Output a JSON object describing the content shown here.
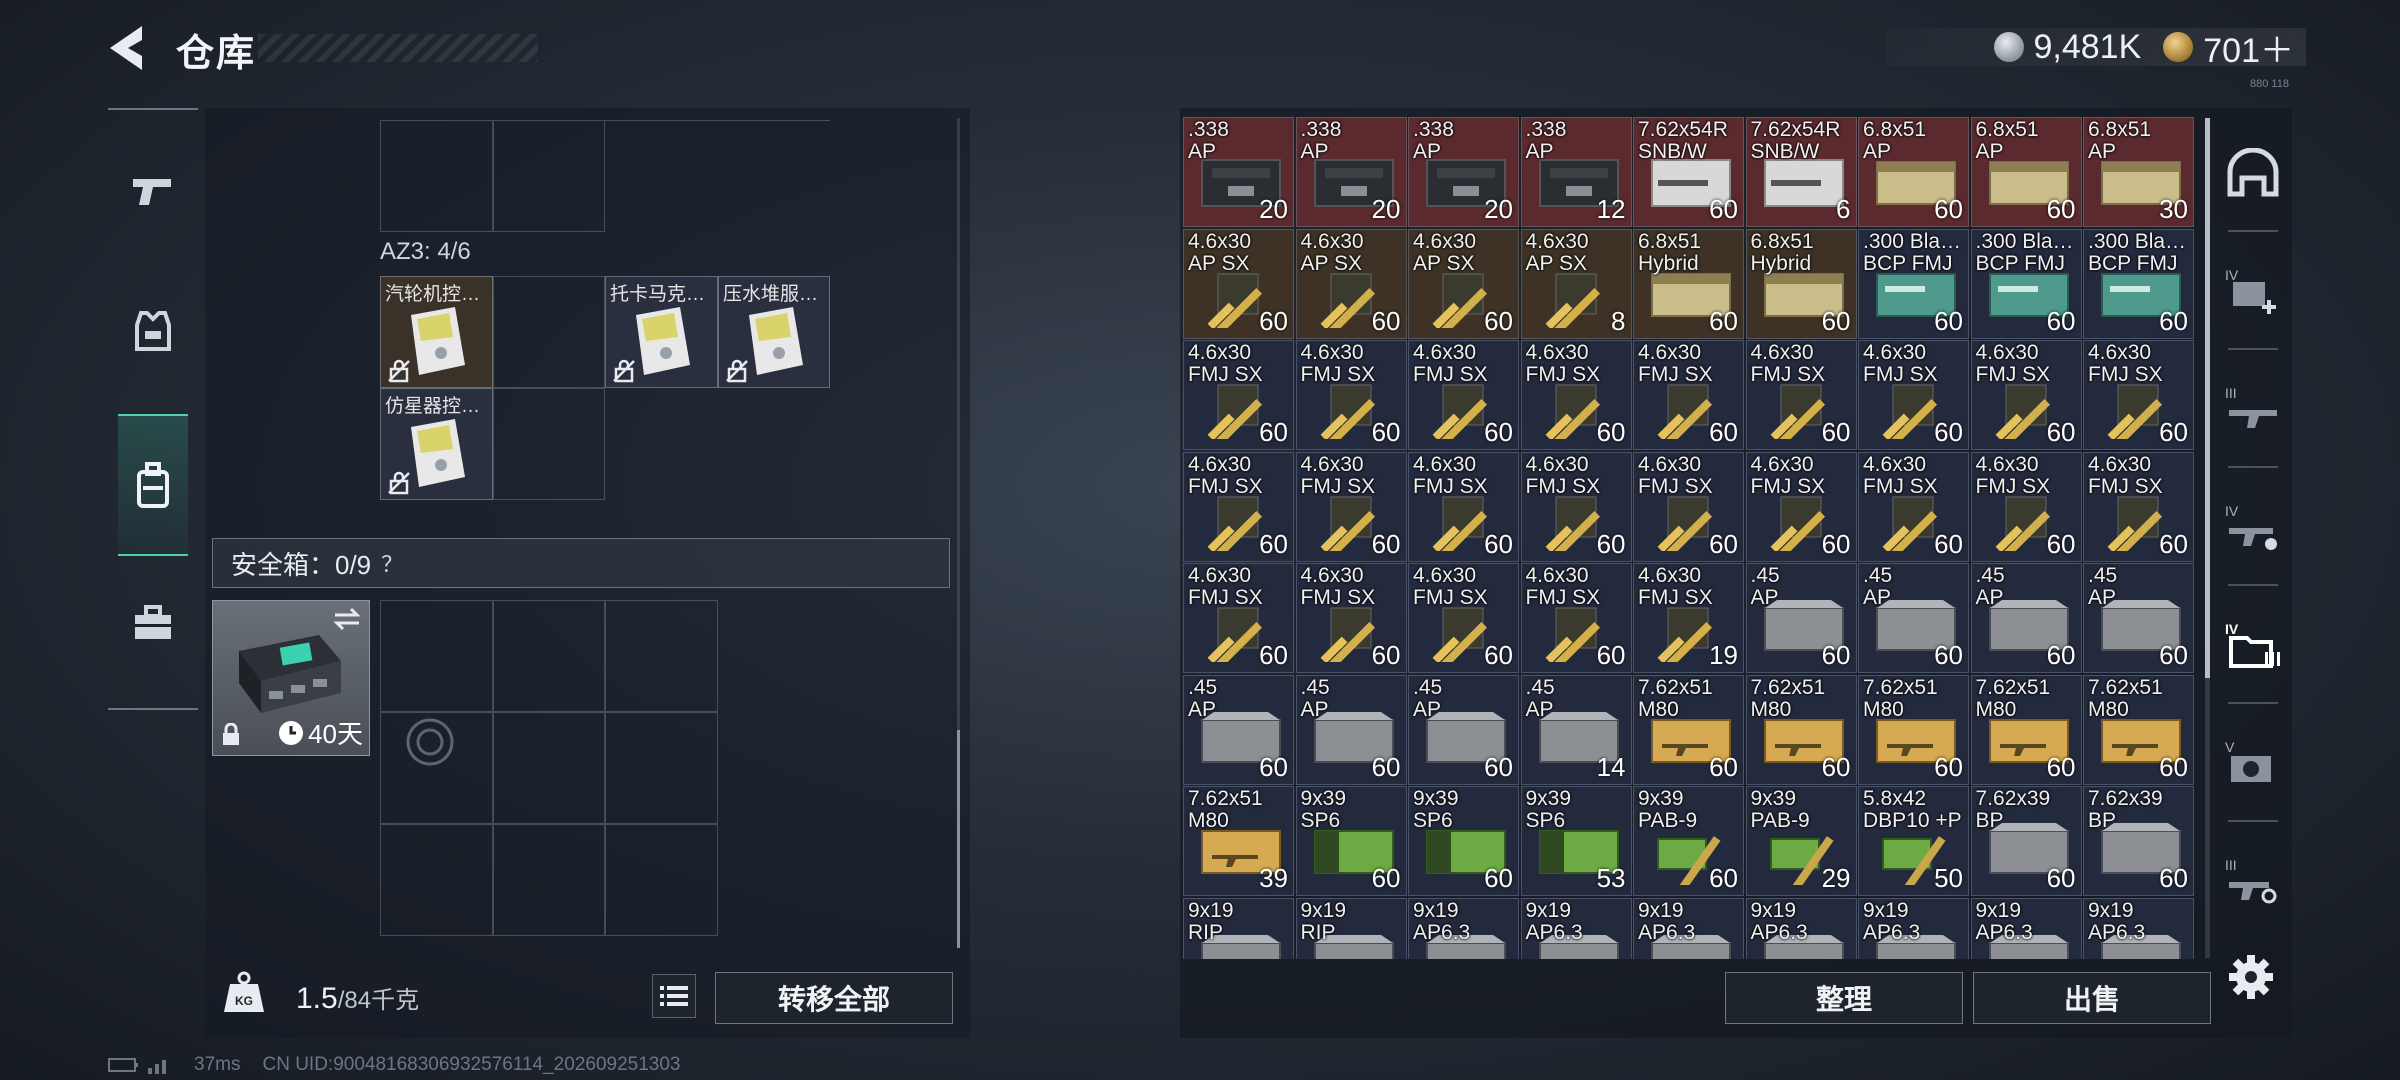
{
  "header": {
    "title": "仓库",
    "currency_silver": "9,481K",
    "currency_gold": "701＋",
    "tiny_text": "880 118"
  },
  "left_nav": {
    "items": [
      "pistol-icon",
      "armor-vest-icon",
      "backpack-icon",
      "toolbox-icon"
    ],
    "active_index": 2
  },
  "container": {
    "label": "AZ3: 4/6",
    "items": [
      {
        "name": "汽轮机控…",
        "style": "brown"
      },
      {
        "name": "托卡马克…",
        "style": "dark"
      },
      {
        "name": "压水堆服…",
        "style": "dark"
      },
      {
        "name": "仿星器控…",
        "style": "dark"
      }
    ]
  },
  "safe_box": {
    "label": "安全箱：0/9",
    "help": "？",
    "duration": "40天"
  },
  "weight": {
    "current": "1.5",
    "max": "/84千克"
  },
  "buttons": {
    "transfer_all": "转移全部",
    "sort": "整理",
    "sell": "出售"
  },
  "status": {
    "ping": "37ms",
    "uid": "CN UID:90048168306932576114_202609251303"
  },
  "colors": {
    "accent": "#4fd0a8",
    "red_cell": "#5a2a2e",
    "brown_cell": "#3d3225",
    "blue_cell": "#242a3e"
  },
  "right_tabs": [
    "helmet-icon",
    "iv-plus-icon",
    "iii-rifle-icon",
    "iv-settings-icon",
    "iv-folder-icon",
    "v-camera-icon",
    "iii-tool-icon"
  ],
  "inventory": [
    [
      {
        "n1": ".338",
        "n2": "AP",
        "c": "20",
        "bg": "red",
        "art": "box-dark"
      },
      {
        "n1": ".338",
        "n2": "AP",
        "c": "20",
        "bg": "red",
        "art": "box-dark"
      },
      {
        "n1": ".338",
        "n2": "AP",
        "c": "20",
        "bg": "red",
        "art": "box-dark"
      },
      {
        "n1": ".338",
        "n2": "AP",
        "c": "12",
        "bg": "red",
        "art": "box-dark"
      },
      {
        "n1": "7.62x54R",
        "n2": "SNB/W",
        "c": "60",
        "bg": "red",
        "art": "box-white"
      },
      {
        "n1": "7.62x54R",
        "n2": "SNB/W",
        "c": "6",
        "bg": "red",
        "art": "box-white"
      },
      {
        "n1": "6.8x51",
        "n2": "AP",
        "c": "60",
        "bg": "red",
        "art": "box-tan"
      },
      {
        "n1": "6.8x51",
        "n2": "AP",
        "c": "60",
        "bg": "red",
        "art": "box-tan"
      },
      {
        "n1": "6.8x51",
        "n2": "AP",
        "c": "30",
        "bg": "red",
        "art": "box-tan"
      }
    ],
    [
      {
        "n1": "4.6x30",
        "n2": "AP SX",
        "c": "60",
        "bg": "brown",
        "art": "shell"
      },
      {
        "n1": "4.6x30",
        "n2": "AP SX",
        "c": "60",
        "bg": "brown",
        "art": "shell"
      },
      {
        "n1": "4.6x30",
        "n2": "AP SX",
        "c": "60",
        "bg": "brown",
        "art": "shell"
      },
      {
        "n1": "4.6x30",
        "n2": "AP SX",
        "c": "8",
        "bg": "brown",
        "art": "shell"
      },
      {
        "n1": "6.8x51",
        "n2": "Hybrid",
        "c": "60",
        "bg": "brown",
        "art": "box-tan"
      },
      {
        "n1": "6.8x51",
        "n2": "Hybrid",
        "c": "60",
        "bg": "brown",
        "art": "box-tan"
      },
      {
        "n1": ".300 Bla…",
        "n2": "BCP FMJ",
        "c": "60",
        "bg": "blue",
        "art": "box-teal"
      },
      {
        "n1": ".300 Bla…",
        "n2": "BCP FMJ",
        "c": "60",
        "bg": "blue",
        "art": "box-teal"
      },
      {
        "n1": ".300 Bla…",
        "n2": "BCP FMJ",
        "c": "60",
        "bg": "blue",
        "art": "box-teal"
      }
    ],
    [
      {
        "n1": "4.6x30",
        "n2": "FMJ SX",
        "c": "60",
        "bg": "blue",
        "art": "shell"
      },
      {
        "n1": "4.6x30",
        "n2": "FMJ SX",
        "c": "60",
        "bg": "blue",
        "art": "shell"
      },
      {
        "n1": "4.6x30",
        "n2": "FMJ SX",
        "c": "60",
        "bg": "blue",
        "art": "shell"
      },
      {
        "n1": "4.6x30",
        "n2": "FMJ SX",
        "c": "60",
        "bg": "blue",
        "art": "shell"
      },
      {
        "n1": "4.6x30",
        "n2": "FMJ SX",
        "c": "60",
        "bg": "blue",
        "art": "shell"
      },
      {
        "n1": "4.6x30",
        "n2": "FMJ SX",
        "c": "60",
        "bg": "blue",
        "art": "shell"
      },
      {
        "n1": "4.6x30",
        "n2": "FMJ SX",
        "c": "60",
        "bg": "blue",
        "art": "shell"
      },
      {
        "n1": "4.6x30",
        "n2": "FMJ SX",
        "c": "60",
        "bg": "blue",
        "art": "shell"
      },
      {
        "n1": "4.6x30",
        "n2": "FMJ SX",
        "c": "60",
        "bg": "blue",
        "art": "shell"
      }
    ],
    [
      {
        "n1": "4.6x30",
        "n2": "FMJ SX",
        "c": "60",
        "bg": "blue",
        "art": "shell"
      },
      {
        "n1": "4.6x30",
        "n2": "FMJ SX",
        "c": "60",
        "bg": "blue",
        "art": "shell"
      },
      {
        "n1": "4.6x30",
        "n2": "FMJ SX",
        "c": "60",
        "bg": "blue",
        "art": "shell"
      },
      {
        "n1": "4.6x30",
        "n2": "FMJ SX",
        "c": "60",
        "bg": "blue",
        "art": "shell"
      },
      {
        "n1": "4.6x30",
        "n2": "FMJ SX",
        "c": "60",
        "bg": "blue",
        "art": "shell"
      },
      {
        "n1": "4.6x30",
        "n2": "FMJ SX",
        "c": "60",
        "bg": "blue",
        "art": "shell"
      },
      {
        "n1": "4.6x30",
        "n2": "FMJ SX",
        "c": "60",
        "bg": "blue",
        "art": "shell"
      },
      {
        "n1": "4.6x30",
        "n2": "FMJ SX",
        "c": "60",
        "bg": "blue",
        "art": "shell"
      },
      {
        "n1": "4.6x30",
        "n2": "FMJ SX",
        "c": "60",
        "bg": "blue",
        "art": "shell"
      }
    ],
    [
      {
        "n1": "4.6x30",
        "n2": "FMJ SX",
        "c": "60",
        "bg": "blue",
        "art": "shell"
      },
      {
        "n1": "4.6x30",
        "n2": "FMJ SX",
        "c": "60",
        "bg": "blue",
        "art": "shell"
      },
      {
        "n1": "4.6x30",
        "n2": "FMJ SX",
        "c": "60",
        "bg": "blue",
        "art": "shell"
      },
      {
        "n1": "4.6x30",
        "n2": "FMJ SX",
        "c": "60",
        "bg": "blue",
        "art": "shell"
      },
      {
        "n1": "4.6x30",
        "n2": "FMJ SX",
        "c": "19",
        "bg": "blue",
        "art": "shell"
      },
      {
        "n1": ".45",
        "n2": "AP",
        "c": "60",
        "bg": "blue",
        "art": "box-grey"
      },
      {
        "n1": ".45",
        "n2": "AP",
        "c": "60",
        "bg": "blue",
        "art": "box-grey"
      },
      {
        "n1": ".45",
        "n2": "AP",
        "c": "60",
        "bg": "blue",
        "art": "box-grey"
      },
      {
        "n1": ".45",
        "n2": "AP",
        "c": "60",
        "bg": "blue",
        "art": "box-grey"
      }
    ],
    [
      {
        "n1": ".45",
        "n2": "AP",
        "c": "60",
        "bg": "blue",
        "art": "box-grey"
      },
      {
        "n1": ".45",
        "n2": "AP",
        "c": "60",
        "bg": "blue",
        "art": "box-grey"
      },
      {
        "n1": ".45",
        "n2": "AP",
        "c": "60",
        "bg": "blue",
        "art": "box-grey"
      },
      {
        "n1": ".45",
        "n2": "AP",
        "c": "14",
        "bg": "blue",
        "art": "box-grey"
      },
      {
        "n1": "7.62x51",
        "n2": "M80",
        "c": "60",
        "bg": "blue",
        "art": "box-yellow"
      },
      {
        "n1": "7.62x51",
        "n2": "M80",
        "c": "60",
        "bg": "blue",
        "art": "box-yellow"
      },
      {
        "n1": "7.62x51",
        "n2": "M80",
        "c": "60",
        "bg": "blue",
        "art": "box-yellow"
      },
      {
        "n1": "7.62x51",
        "n2": "M80",
        "c": "60",
        "bg": "blue",
        "art": "box-yellow"
      },
      {
        "n1": "7.62x51",
        "n2": "M80",
        "c": "60",
        "bg": "blue",
        "art": "box-yellow"
      }
    ],
    [
      {
        "n1": "7.62x51",
        "n2": "M80",
        "c": "39",
        "bg": "blue",
        "art": "box-yellow"
      },
      {
        "n1": "9x39",
        "n2": "SP6",
        "c": "60",
        "bg": "blue",
        "art": "box-green"
      },
      {
        "n1": "9x39",
        "n2": "SP6",
        "c": "60",
        "bg": "blue",
        "art": "box-green"
      },
      {
        "n1": "9x39",
        "n2": "SP6",
        "c": "53",
        "bg": "blue",
        "art": "box-green"
      },
      {
        "n1": "9x39",
        "n2": "PAB-9",
        "c": "60",
        "bg": "blue",
        "art": "cartridge"
      },
      {
        "n1": "9x39",
        "n2": "PAB-9",
        "c": "29",
        "bg": "blue",
        "art": "cartridge"
      },
      {
        "n1": "5.8x42",
        "n2": "DBP10 +P",
        "c": "50",
        "bg": "blue",
        "art": "cartridge"
      },
      {
        "n1": "7.62x39",
        "n2": "BP",
        "c": "60",
        "bg": "blue",
        "art": "box-grey"
      },
      {
        "n1": "7.62x39",
        "n2": "BP",
        "c": "60",
        "bg": "blue",
        "art": "box-grey"
      }
    ],
    [
      {
        "n1": "9x19",
        "n2": "RIP",
        "c": "",
        "bg": "blue",
        "art": "box-grey"
      },
      {
        "n1": "9x19",
        "n2": "RIP",
        "c": "",
        "bg": "blue",
        "art": "box-grey"
      },
      {
        "n1": "9x19",
        "n2": "AP6.3",
        "c": "",
        "bg": "blue",
        "art": "box-grey"
      },
      {
        "n1": "9x19",
        "n2": "AP6.3",
        "c": "",
        "bg": "blue",
        "art": "box-grey"
      },
      {
        "n1": "9x19",
        "n2": "AP6.3",
        "c": "",
        "bg": "blue",
        "art": "box-grey"
      },
      {
        "n1": "9x19",
        "n2": "AP6.3",
        "c": "",
        "bg": "blue",
        "art": "box-grey"
      },
      {
        "n1": "9x19",
        "n2": "AP6.3",
        "c": "",
        "bg": "blue",
        "art": "box-grey"
      },
      {
        "n1": "9x19",
        "n2": "AP6.3",
        "c": "",
        "bg": "blue",
        "art": "box-grey"
      },
      {
        "n1": "9x19",
        "n2": "AP6.3",
        "c": "",
        "bg": "blue",
        "art": "box-grey"
      }
    ]
  ]
}
